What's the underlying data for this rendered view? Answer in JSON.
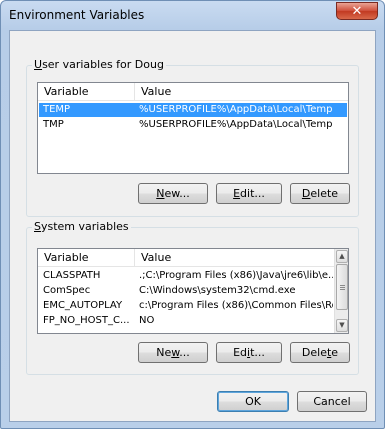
{
  "window": {
    "title": "Environment Variables",
    "close_glyph": "✕"
  },
  "user_vars": {
    "label_prefix": "",
    "label_mnemonic": "U",
    "label_rest": "ser variables for Doug",
    "col_variable": "Variable",
    "col_value": "Value",
    "rows": [
      {
        "name": "TEMP",
        "value": "%USERPROFILE%\\AppData\\Local\\Temp",
        "selected": true
      },
      {
        "name": "TMP",
        "value": "%USERPROFILE%\\AppData\\Local\\Temp",
        "selected": false
      }
    ],
    "new_prefix": "",
    "new_mnemonic": "N",
    "new_rest": "ew...",
    "edit_prefix": "",
    "edit_mnemonic": "E",
    "edit_rest": "dit...",
    "delete_prefix": "",
    "delete_mnemonic": "D",
    "delete_rest": "elete"
  },
  "system_vars": {
    "label_prefix": "",
    "label_mnemonic": "S",
    "label_rest": "ystem variables",
    "col_variable": "Variable",
    "col_value": "Value",
    "rows": [
      {
        "name": "CLASSPATH",
        "value": ".;C:\\Program Files (x86)\\Java\\jre6\\lib\\e..."
      },
      {
        "name": "ComSpec",
        "value": "C:\\Windows\\system32\\cmd.exe"
      },
      {
        "name": "EMC_AUTOPLAY",
        "value": "c:\\Program Files (x86)\\Common Files\\Ro..."
      },
      {
        "name": "FP_NO_HOST_C...",
        "value": "NO"
      }
    ],
    "new_prefix": "Ne",
    "new_mnemonic": "w",
    "new_rest": "...",
    "edit_prefix": "Ed",
    "edit_mnemonic": "i",
    "edit_rest": "t...",
    "delete_prefix": "Dele",
    "delete_mnemonic": "t",
    "delete_rest": "e"
  },
  "buttons": {
    "ok": "OK",
    "cancel": "Cancel"
  },
  "scrollbar": {
    "up_glyph": "▲",
    "down_glyph": "▼"
  }
}
